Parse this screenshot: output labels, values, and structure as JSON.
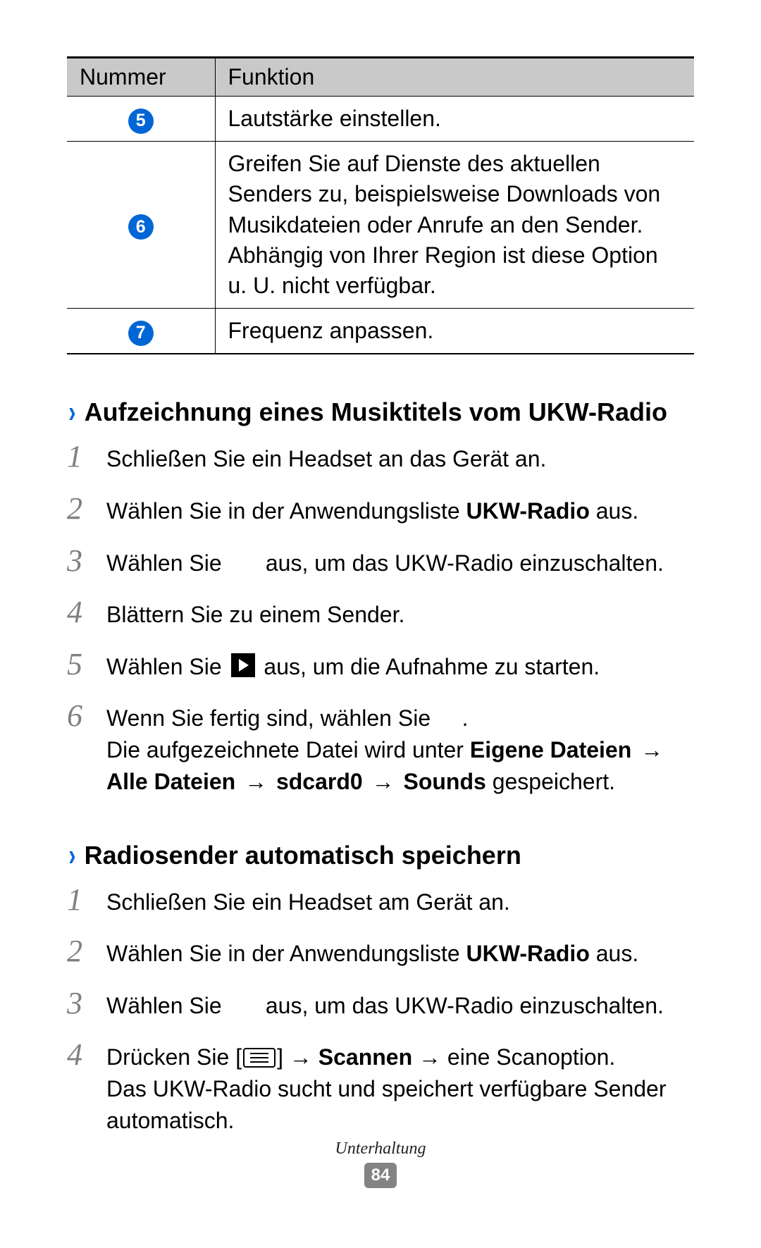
{
  "table": {
    "headers": {
      "num": "Nummer",
      "func": "Funktion"
    },
    "rows": [
      {
        "n": "5",
        "text": "Lautstärke einstellen."
      },
      {
        "n": "6",
        "text": "Greifen Sie auf Dienste des aktuellen Senders zu, beispielsweise Downloads von Musikdateien oder Anrufe an den Sender. Abhängig von Ihrer Region ist diese Option u. U. nicht verfügbar."
      },
      {
        "n": "7",
        "text": "Frequenz anpassen."
      }
    ]
  },
  "section1": {
    "title": "Aufzeichnung eines Musiktitels vom UKW-Radio",
    "steps": {
      "s1": "Schließen Sie ein Headset an das Gerät an.",
      "s2a": "Wählen Sie in der Anwendungsliste ",
      "s2b": "UKW-Radio",
      "s2c": " aus.",
      "s3a": "Wählen Sie ",
      "s3b": " aus, um das UKW-Radio einzuschalten.",
      "s4": "Blättern Sie zu einem Sender.",
      "s5a": "Wählen Sie ",
      "s5b": " aus, um die Aufnahme zu starten.",
      "s6a": "Wenn Sie fertig sind, wählen Sie ",
      "s6b": ".",
      "note_a": "Die aufgezeichnete Datei wird unter ",
      "note_b1": "Eigene Dateien",
      "note_arrow": " → ",
      "note_b2": "Alle Dateien",
      "note_b3": "sdcard0",
      "note_b4": "Sounds",
      "note_c": " gespeichert."
    }
  },
  "section2": {
    "title": "Radiosender automatisch speichern",
    "steps": {
      "s1": "Schließen Sie ein Headset am Gerät an.",
      "s2a": "Wählen Sie in der Anwendungsliste ",
      "s2b": "UKW-Radio",
      "s2c": " aus.",
      "s3a": "Wählen Sie ",
      "s3b": " aus, um das UKW-Radio einzuschalten.",
      "s4a": "Drücken Sie [",
      "s4b": "] → ",
      "s4c": "Scannen",
      "s4d": " → eine Scanoption.",
      "note": "Das UKW-Radio sucht und speichert verfügbare Sender automatisch."
    }
  },
  "footer": {
    "category": "Unterhaltung",
    "page": "84"
  },
  "nums": {
    "1": "1",
    "2": "2",
    "3": "3",
    "4": "4",
    "5": "5",
    "6": "6"
  }
}
